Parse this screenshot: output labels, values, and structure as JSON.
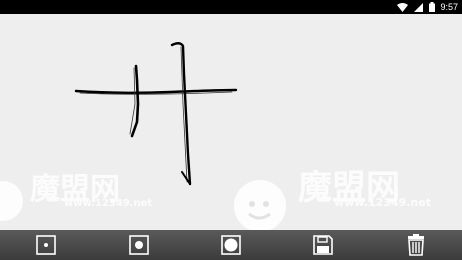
{
  "status_bar": {
    "time": "9:57",
    "icons": [
      "wifi-icon",
      "signal-icon",
      "battery-icon"
    ]
  },
  "canvas": {
    "strokes_description_icon": "handwritten-strokes"
  },
  "watermarks": [
    {
      "title": "魔盟网",
      "url": "www.12349.net"
    },
    {
      "title": "魔盟网",
      "url": "www.12349.net"
    }
  ],
  "toolbar": {
    "buttons": [
      {
        "icon": "small-brush-icon"
      },
      {
        "icon": "medium-brush-icon"
      },
      {
        "icon": "large-brush-icon"
      },
      {
        "icon": "save-icon"
      },
      {
        "icon": "trash-icon"
      }
    ]
  }
}
